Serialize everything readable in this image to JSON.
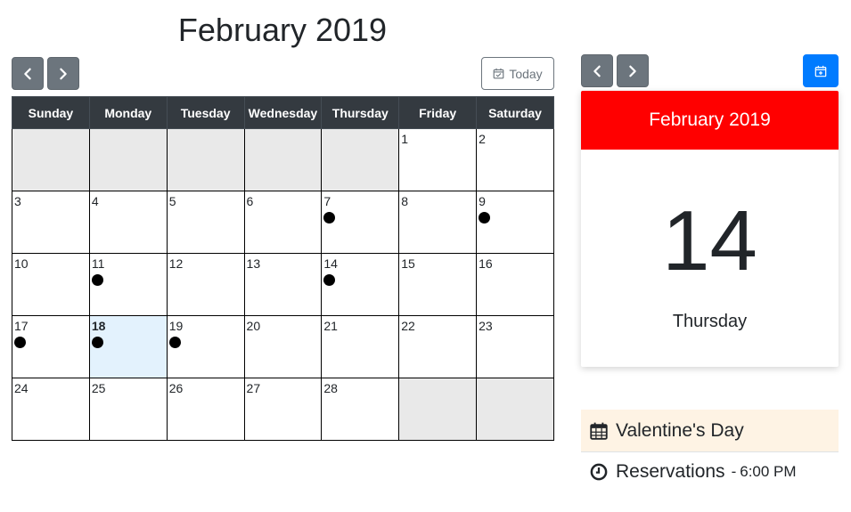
{
  "calendar": {
    "title": "February 2019",
    "today_label": "Today",
    "weekdays": [
      "Sunday",
      "Monday",
      "Tuesday",
      "Wednesday",
      "Thursday",
      "Friday",
      "Saturday"
    ],
    "today": 18,
    "weeks": [
      [
        null,
        null,
        null,
        null,
        null,
        1,
        2
      ],
      [
        3,
        4,
        5,
        6,
        7,
        8,
        9
      ],
      [
        10,
        11,
        12,
        13,
        14,
        15,
        16
      ],
      [
        17,
        18,
        19,
        20,
        21,
        22,
        23
      ],
      [
        24,
        25,
        26,
        27,
        28,
        null,
        null
      ]
    ],
    "event_days": [
      7,
      9,
      11,
      14,
      17,
      18,
      19
    ]
  },
  "detail": {
    "month_title": "February 2019",
    "day_number": "14",
    "weekday": "Thursday",
    "header_color": "#ff0000"
  },
  "events": [
    {
      "icon": "calendar-icon",
      "title": "Valentine's Day"
    },
    {
      "icon": "clock-icon",
      "title": "Reservations",
      "separator": "-",
      "time": "6:00 PM"
    }
  ],
  "colors": {
    "nav_button": "#6c757d",
    "primary": "#007bff",
    "weekday_header": "#343a40",
    "today_cell": "#e3f2fd",
    "empty_cell": "#e9e9e9",
    "event_highlight": "#fef3e4"
  }
}
